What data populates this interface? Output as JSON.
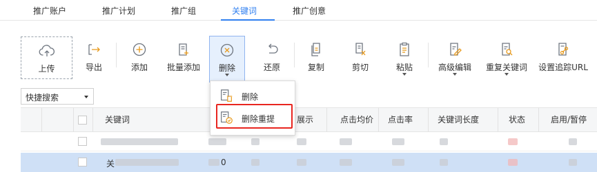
{
  "tabs": [
    "推广账户",
    "推广计划",
    "推广组",
    "关键词",
    "推广创意"
  ],
  "active_tab": "关键词",
  "toolbar": {
    "upload": "上传",
    "export": "导出",
    "add": "添加",
    "bulk_add": "批量添加",
    "delete": "删除",
    "restore": "还原",
    "copy": "复制",
    "cut": "剪切",
    "paste": "粘贴",
    "advanced_edit": "高级编辑",
    "duplicate_keywords": "重复关键词",
    "tracking_url": "设置追踪URL"
  },
  "filter": {
    "selected": "快捷搜索"
  },
  "table": {
    "headers": {
      "keyword": "关键词",
      "impressions": "展示",
      "avg_cpc": "点击均价",
      "ctr": "点击率",
      "keyword_length": "关键词长度",
      "status": "状态",
      "enable_pause": "启用/暂停"
    },
    "rows": [
      {
        "prefix": "",
        "mid": ""
      },
      {
        "prefix": "关",
        "mid": "0"
      }
    ]
  },
  "delete_menu": {
    "items": [
      "删除",
      "删除重提"
    ]
  },
  "colors": {
    "accent": "#2f7ff0",
    "icon": "#6f7680",
    "icon_accent": "#e89a1c",
    "highlight_box": "#e8251f",
    "selected_row": "#cfe0f6"
  }
}
